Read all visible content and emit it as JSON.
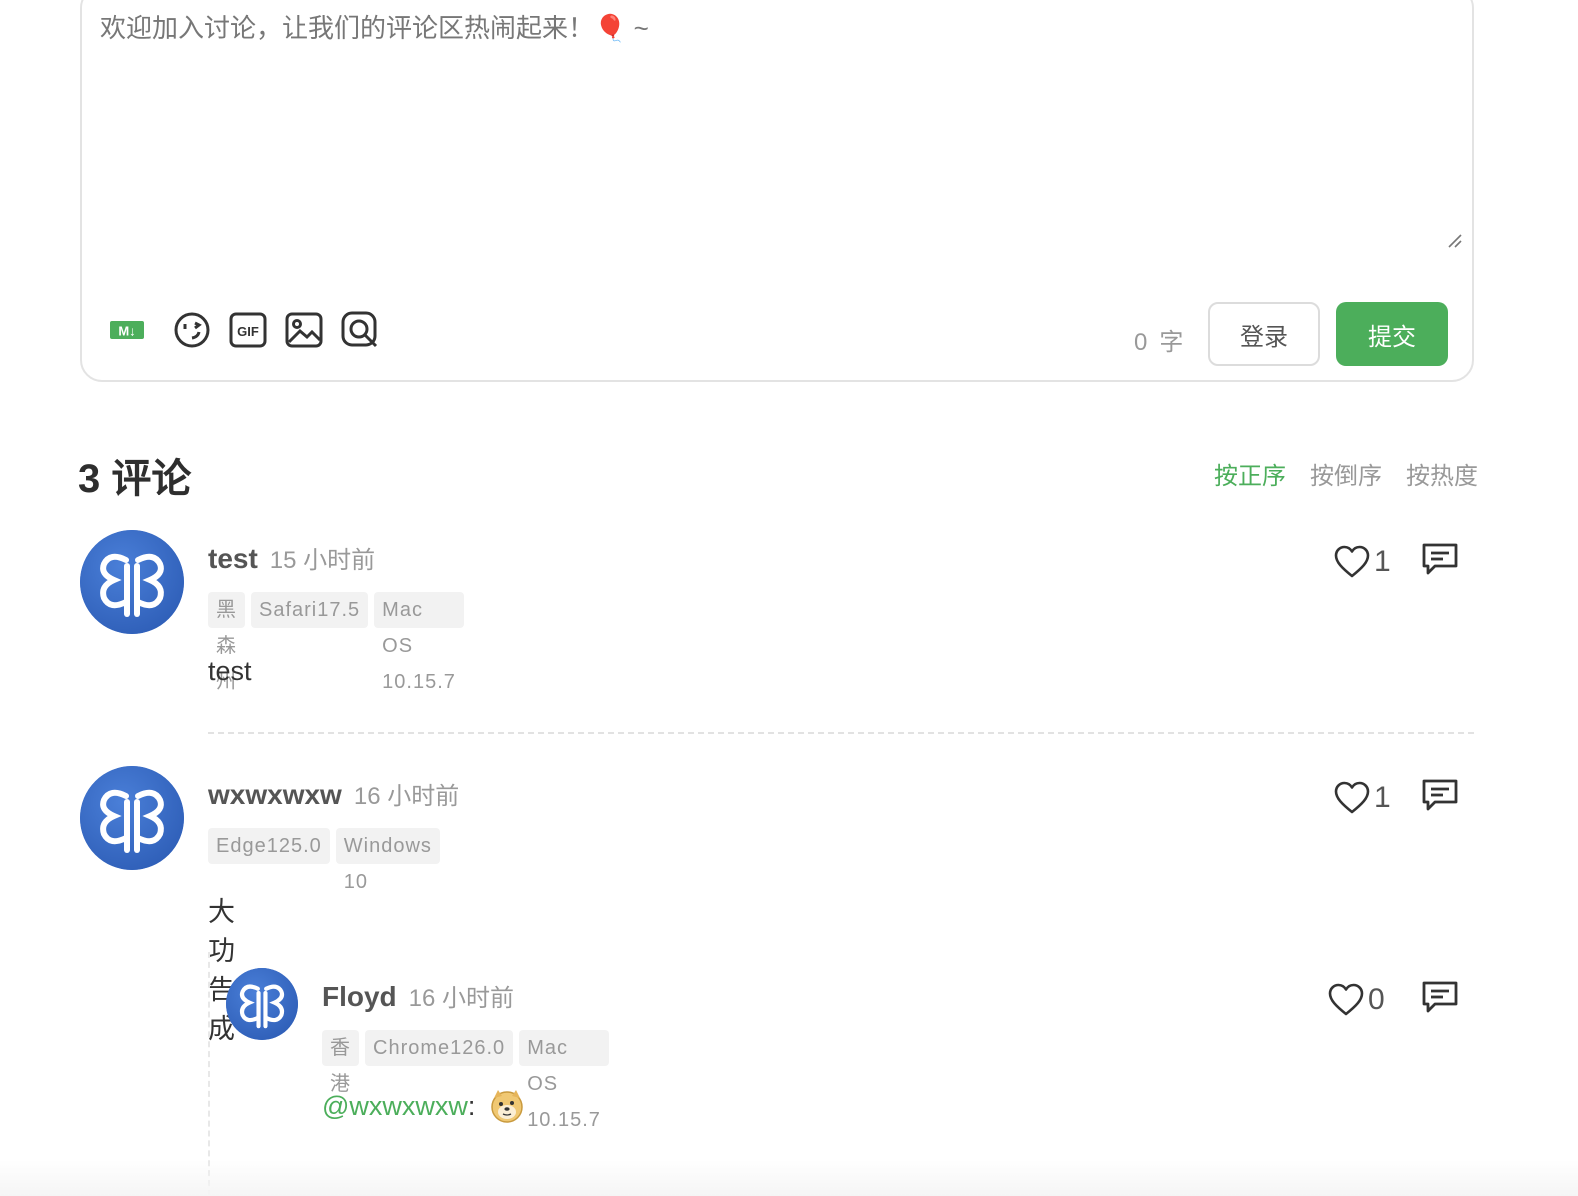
{
  "editor": {
    "placeholder": "欢迎加入讨论，让我们的评论区热闹起来！",
    "placeholder_emoji": "🎈",
    "placeholder_tail": " ~",
    "word_count": "0",
    "word_unit": "字",
    "login_label": "登录",
    "submit_label": "提交",
    "markdown_badge": "M↓",
    "gif_label": "GIF"
  },
  "header": {
    "count_title": "3 评论",
    "sort_options": [
      "按正序",
      "按倒序",
      "按热度"
    ],
    "active_sort": "按正序"
  },
  "comments": [
    {
      "nick": "test",
      "time": "15 小时前",
      "tags": [
        "黑森州",
        "Safari17.5",
        "Mac OS 10.15.7"
      ],
      "content": "test",
      "likes": "1"
    },
    {
      "nick": "wxwxwxw",
      "time": "16 小时前",
      "tags": [
        "Edge125.0",
        "Windows 10"
      ],
      "content": "大功告成",
      "likes": "1",
      "replies": [
        {
          "nick": "Floyd",
          "time": "16 小时前",
          "tags": [
            "香港",
            "Chrome126.0",
            "Mac OS 10.15.7"
          ],
          "mention": "@wxwxwxw",
          "content_suffix": ":",
          "emoji": "doge-emoji",
          "likes": "0"
        }
      ]
    }
  ],
  "colors": {
    "accent": "#4cae5b",
    "avatar_bg": "#3a6cc7",
    "tag_bg": "#f2f2f2"
  },
  "icons": [
    "markdown-icon",
    "emoji-icon",
    "gif-icon",
    "image-icon",
    "preview-icon",
    "heart-icon",
    "reply-icon"
  ]
}
